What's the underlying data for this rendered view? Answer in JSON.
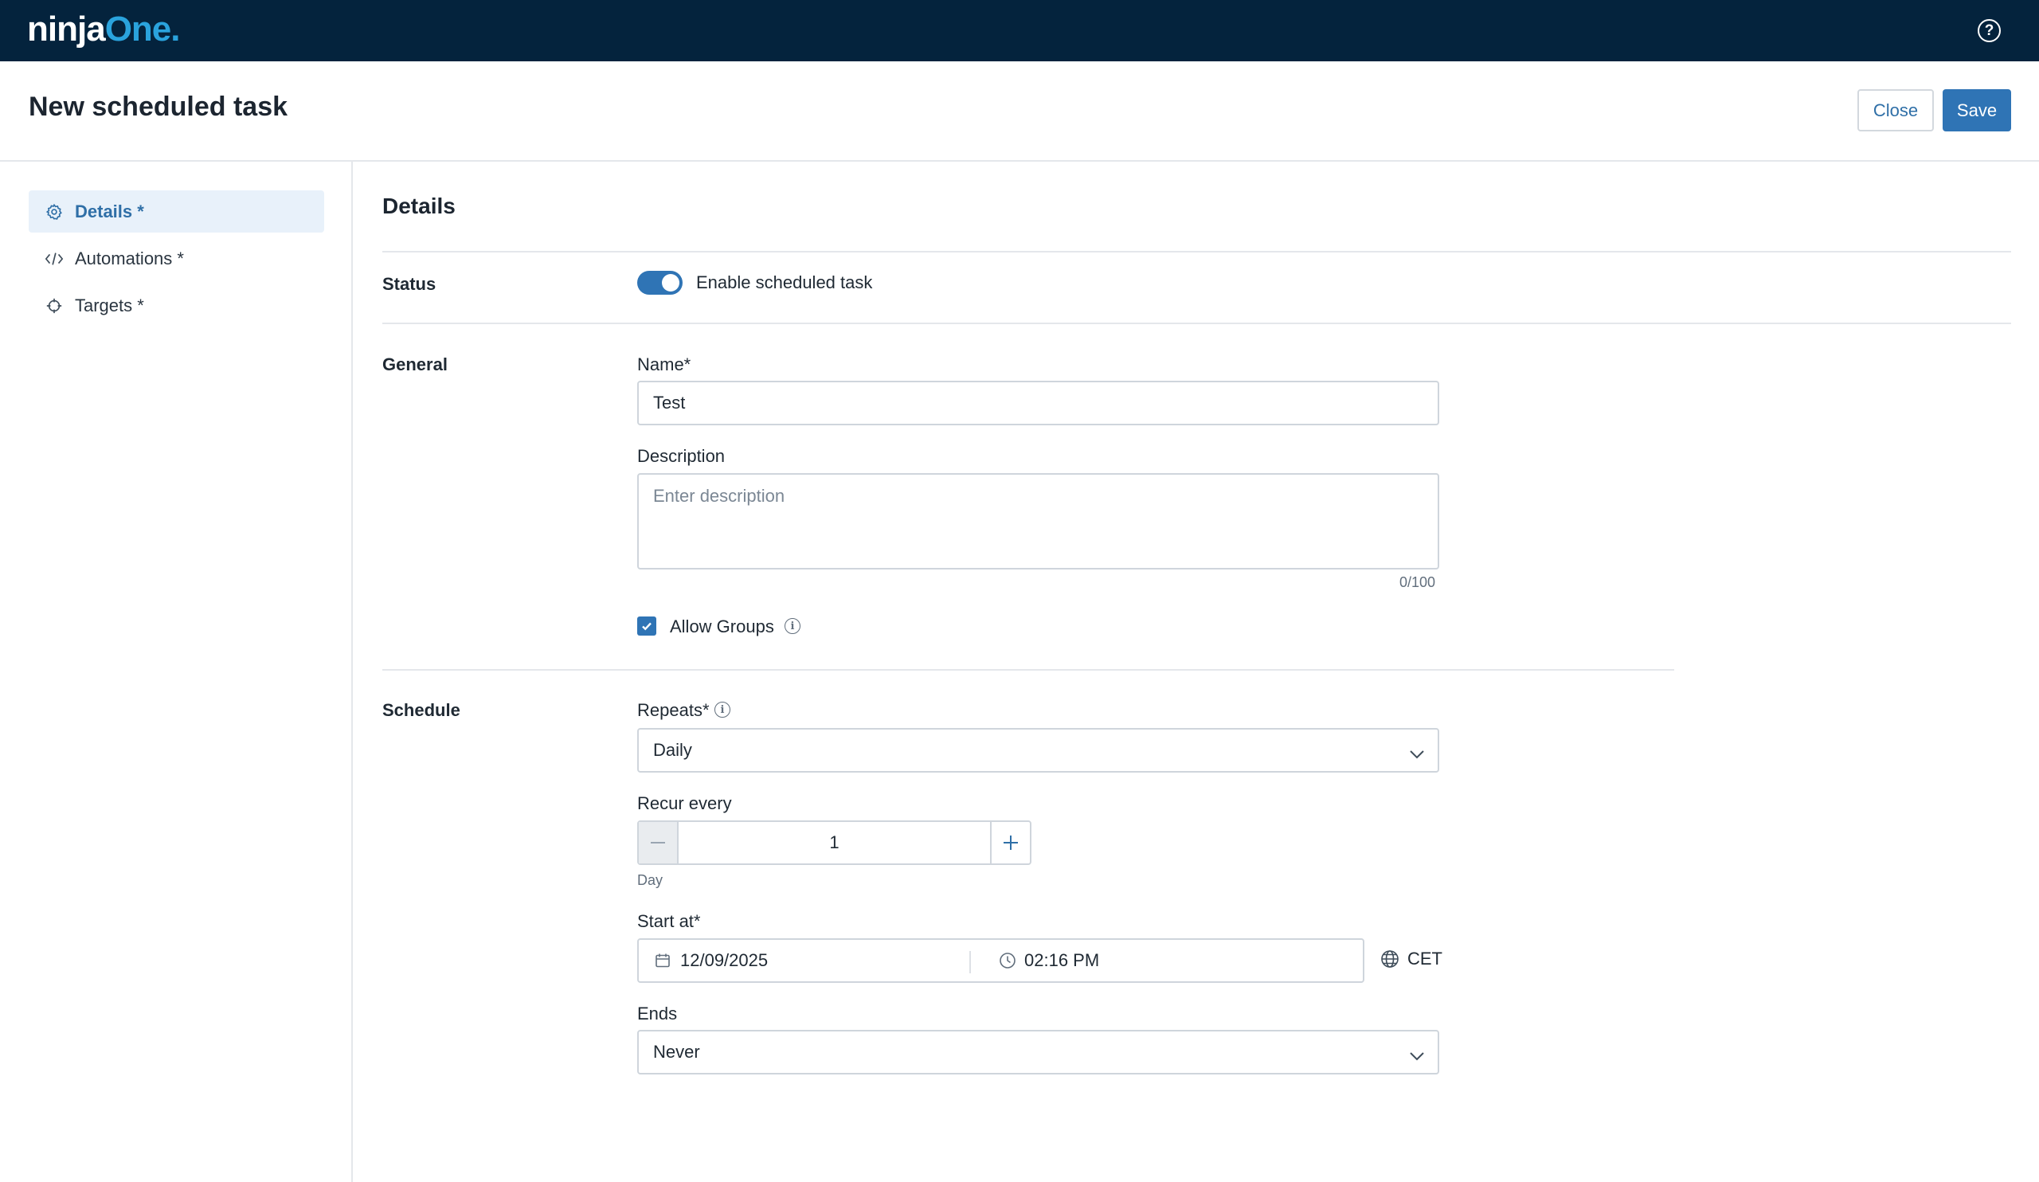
{
  "app": {
    "logo_main": "ninja",
    "logo_accent": "One",
    "logo_dot": "."
  },
  "header": {
    "title": "New scheduled task",
    "close_label": "Close",
    "save_label": "Save"
  },
  "sidebar": {
    "items": [
      {
        "label": "Details *",
        "icon": "gear-icon",
        "active": true
      },
      {
        "label": "Automations *",
        "icon": "code-icon",
        "active": false
      },
      {
        "label": "Targets *",
        "icon": "crosshair-icon",
        "active": false
      }
    ]
  },
  "details": {
    "section_title": "Details",
    "status": {
      "label": "Status",
      "toggle_text": "Enable scheduled task",
      "enabled": true
    },
    "general": {
      "label": "General",
      "name_label": "Name*",
      "name_value": "Test",
      "description_label": "Description",
      "description_placeholder": "Enter description",
      "description_counter": "0/100",
      "allow_groups_label": "Allow Groups",
      "allow_groups_checked": true
    },
    "schedule": {
      "label": "Schedule",
      "repeats_label": "Repeats*",
      "repeats_value": "Daily",
      "recur_label": "Recur every",
      "recur_value": "1",
      "recur_unit": "Day",
      "start_label": "Start at*",
      "start_date": "12/09/2025",
      "start_time": "02:16 PM",
      "timezone": "CET",
      "ends_label": "Ends",
      "ends_value": "Never"
    }
  },
  "colors": {
    "topbar": "#04233d",
    "accent": "#2f74b5",
    "logo_accent": "#2aa3dd"
  }
}
